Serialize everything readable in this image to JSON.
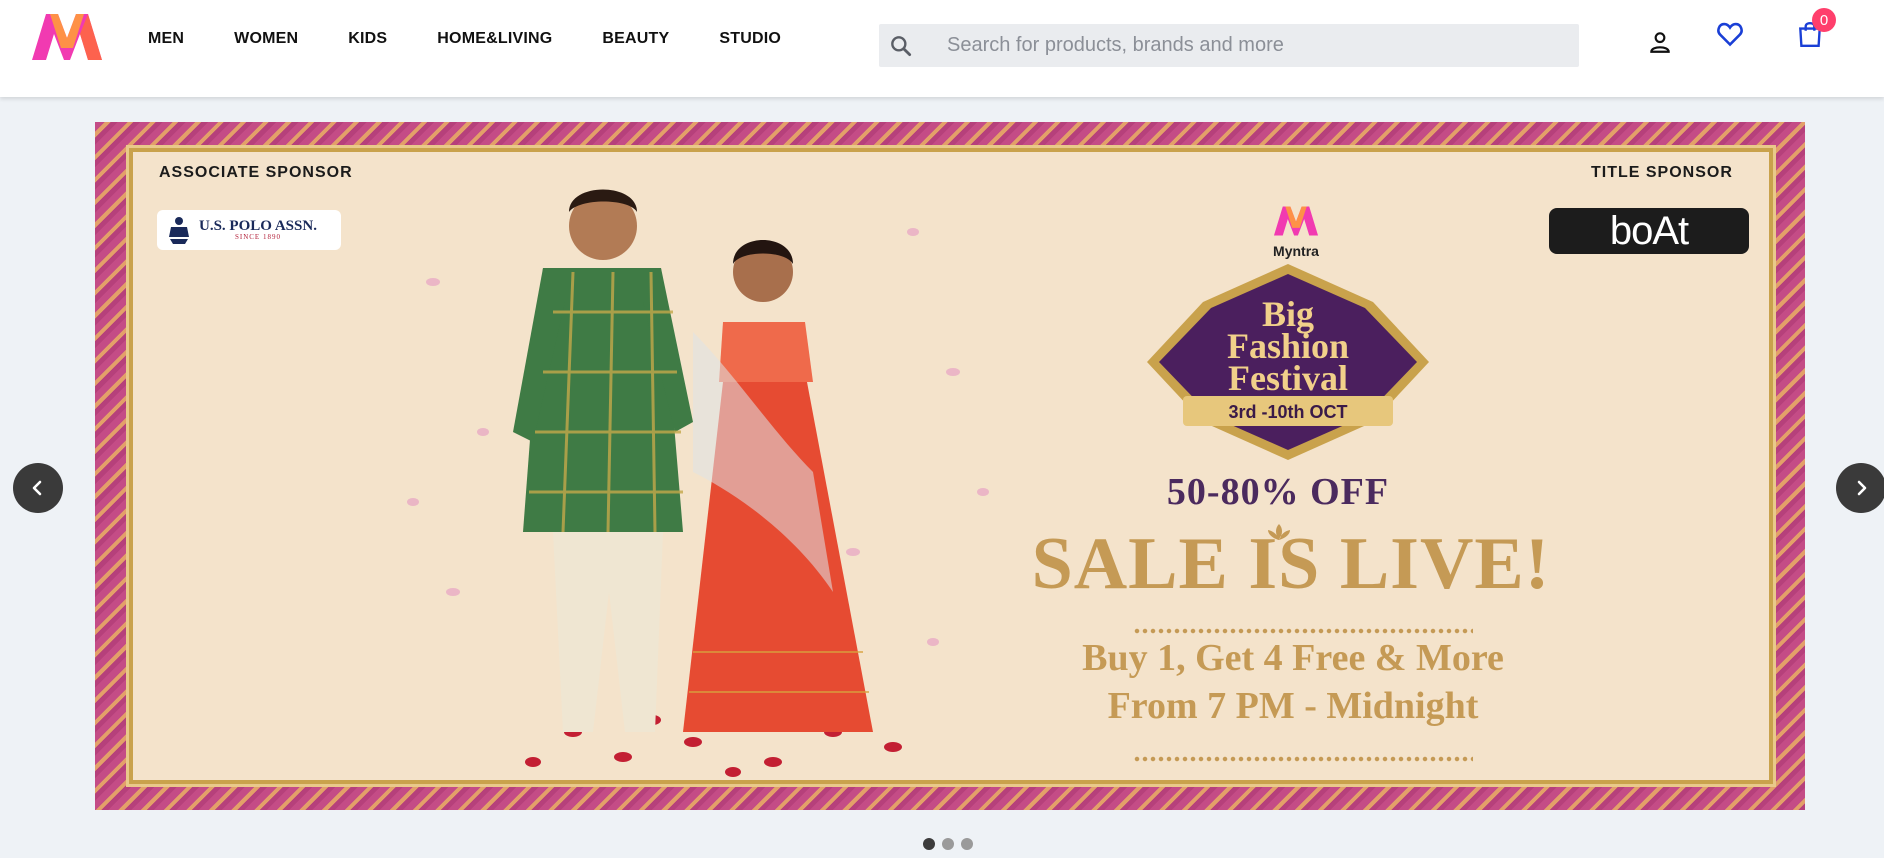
{
  "header": {
    "nav": [
      "MEN",
      "WOMEN",
      "KIDS",
      "HOME&LIVING",
      "BEAUTY",
      "STUDIO"
    ],
    "search_placeholder": "Search for products, brands and more",
    "bag_count": "0",
    "icons": {
      "logo": "myntra-logo-icon",
      "search": "search-icon",
      "profile": "profile-icon",
      "wishlist": "heart-icon",
      "bag": "bag-icon"
    }
  },
  "banner": {
    "associate_sponsor_label": "ASSOCIATE SPONSOR",
    "associate_sponsor_name": "U.S. POLO ASSN.",
    "associate_sponsor_since": "SINCE 1890",
    "title_sponsor_label": "TITLE SPONSOR",
    "title_sponsor_name": "boAt",
    "brand": "Myntra",
    "event_line1": "Big",
    "event_line2": "Fashion",
    "event_line3": "Festival",
    "event_dates": "3rd -10th OCT",
    "discount": "50-80% OFF",
    "headline": "SALE IS LIVE!",
    "offer_line1": "Buy 1, Get 4 Free & More",
    "offer_line2": "From 7 PM - Midnight"
  },
  "carousel": {
    "slides": 3,
    "active_slide": 1,
    "prev_icon": "chevron-left-icon",
    "next_icon": "chevron-right-icon"
  },
  "colors": {
    "brand_pink": "#ff3f6c",
    "wishlist_blue": "#1a3fd6",
    "banner_purple": "#4b2a5e",
    "banner_gold": "#c59a55"
  }
}
